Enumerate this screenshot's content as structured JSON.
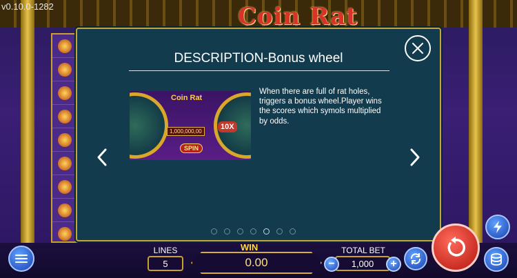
{
  "version": "v0.10.0-1282",
  "game_logo": "Coin Rat",
  "modal": {
    "title": "DESCRIPTION-Bonus wheel",
    "description": "When there are full of rat holes, triggers a bonus wheel.Player wins the scores which symols multiplied by odds.",
    "image": {
      "logo": "Coin Rat",
      "amount": "1,000,000,00",
      "multiplier": "10X",
      "spin_label": "SPIN"
    },
    "pagination": {
      "total": 7,
      "active_index": 4
    }
  },
  "bottom_bar": {
    "lines_label": "LINES",
    "lines_value": "5",
    "win_label": "WIN",
    "win_value": "0.00",
    "total_bet_label": "TOTAL BET",
    "total_bet_value": "1,000",
    "minus_label": "−",
    "plus_label": "+"
  },
  "colors": {
    "modal_bg": "#123c4e",
    "gold": "#c8a43a",
    "spin_red": "#d0201a",
    "button_blue": "#1d43b8"
  },
  "icons": [
    "menu-icon",
    "close-icon",
    "chevron-left-icon",
    "chevron-right-icon",
    "autoplay-icon",
    "spin-icon",
    "turbo-icon",
    "coins-icon"
  ]
}
